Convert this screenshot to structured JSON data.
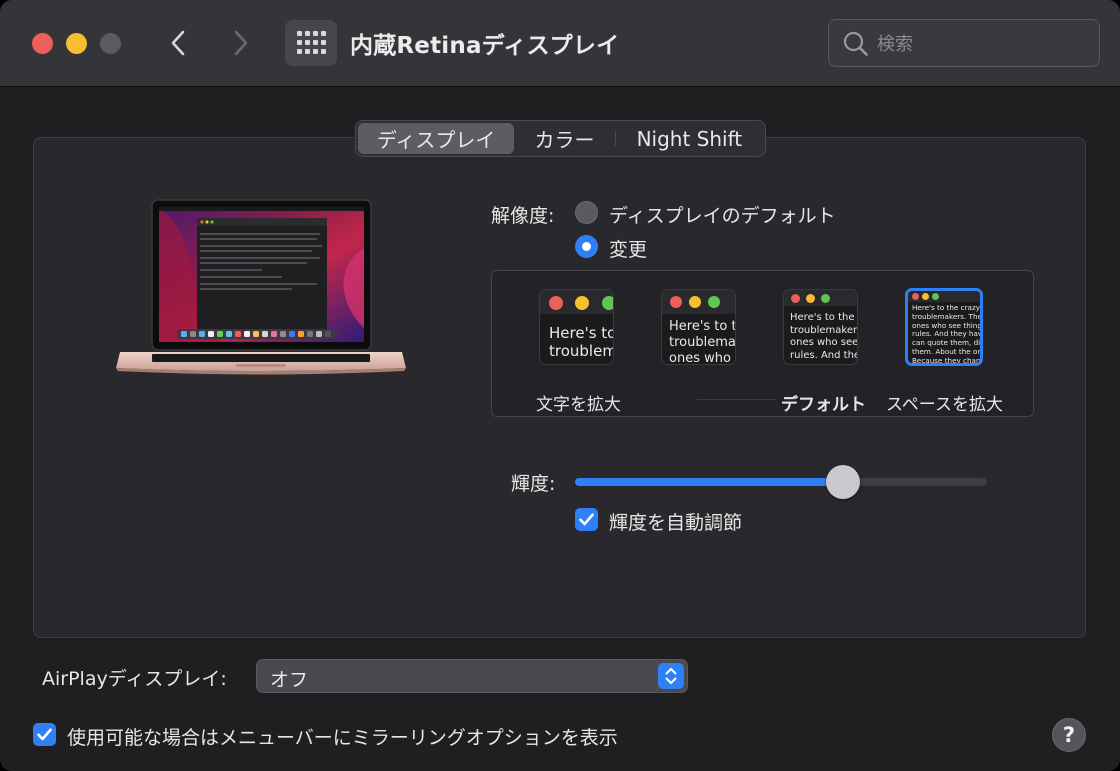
{
  "window": {
    "title": "内蔵Retinaディスプレイ"
  },
  "toolbar": {
    "back_icon": "chevron-left-icon",
    "forward_icon": "chevron-right-icon",
    "grid_icon": "grid-icon"
  },
  "search": {
    "placeholder": "検索",
    "value": ""
  },
  "tabs": [
    {
      "label": "ディスプレイ",
      "selected": true
    },
    {
      "label": "カラー",
      "selected": false
    },
    {
      "label": "Night Shift",
      "selected": false
    }
  ],
  "resolution": {
    "label": "解像度:",
    "options": [
      {
        "label": "ディスプレイのデフォルト",
        "selected": false
      },
      {
        "label": "変更",
        "selected": true
      }
    ],
    "scale_options": [
      {
        "label": "文字を拡大",
        "preview_text": "Here's to\ntroublem",
        "selected": false
      },
      {
        "label": "",
        "preview_text": "Here's to t\ntroublema\nones who",
        "selected": false
      },
      {
        "label": "デフォルト",
        "preview_text": "Here's to the cr\ntroublemakers.\nones who see t\nrules. And they",
        "selected": false
      },
      {
        "label": "スペースを拡大",
        "preview_text": "Here's to the crazy one\ntroublemakers. The rou\nones who see things dif\nrules. And they have no\ncan quote them, disagr\nthem. About the only th\nBecause they change th",
        "selected": true
      }
    ]
  },
  "brightness": {
    "label": "輝度:",
    "level": 0.65,
    "auto_label": "輝度を自動調節",
    "auto_checked": true
  },
  "airplay": {
    "label": "AirPlayディスプレイ:",
    "value": "オフ"
  },
  "mirroring": {
    "label": "使用可能な場合はメニューバーにミラーリングオプションを表示",
    "checked": true
  },
  "help": {
    "label": "?"
  },
  "colors": {
    "accent": "#2f7ff5",
    "close": "#ed5f59",
    "minimize": "#f5bf2f",
    "window_bg": "#1f1e21"
  }
}
